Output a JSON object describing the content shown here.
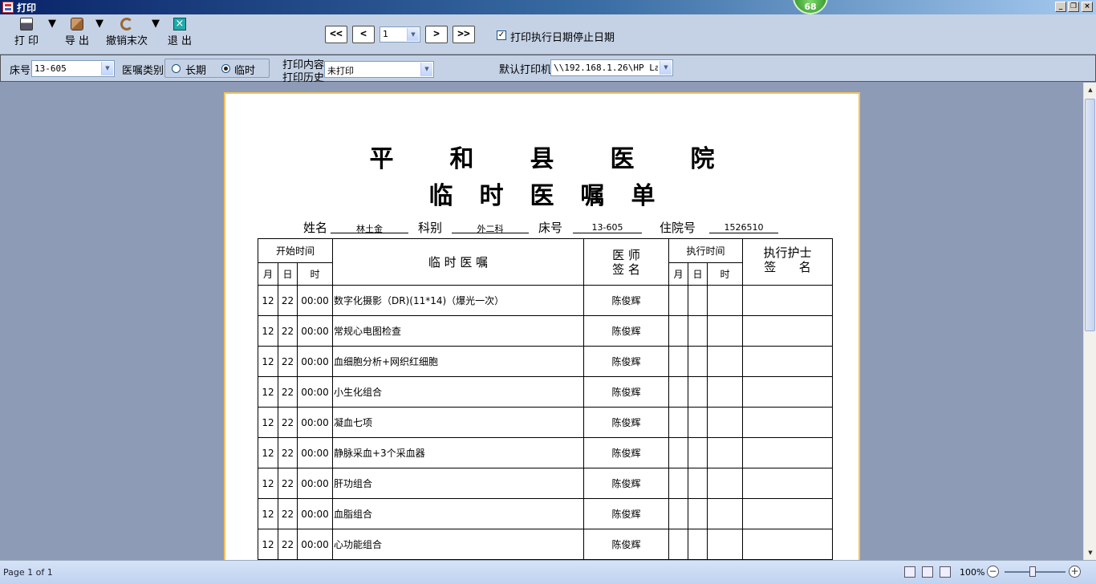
{
  "window": {
    "title": "打印",
    "badge": "68",
    "controls": [
      "_",
      "❐",
      "×"
    ]
  },
  "toolbar": {
    "print_label": "打 印",
    "export_label": "导 出",
    "undo_label": "撤销末次",
    "exit_label": "退 出",
    "nav": {
      "first": "<<",
      "prev": "<",
      "next": ">",
      "last": ">>"
    },
    "page_value": "1",
    "stop_date_checkbox": {
      "label": "打印执行日期停止日期",
      "checked": true
    }
  },
  "filters": {
    "bed_label": "床号",
    "bed_value": "13-605",
    "order_type_label": "医嘱类别",
    "order_type_options": [
      "长期",
      "临时"
    ],
    "order_type_selected": "临时",
    "print_content_label": "打印内容",
    "print_history_label": "打印历史",
    "print_history_value": "未打印",
    "printer_label": "默认打印机",
    "printer_value": "\\\\192.168.1.26\\HP La"
  },
  "document": {
    "hospital": "平和县医院",
    "title": "临时医嘱单",
    "patient": {
      "name_label": "姓名",
      "name": "林土金",
      "dept_label": "科别",
      "dept": "外二科",
      "bed_label": "床号",
      "bed": "13-605",
      "admission_label": "住院号",
      "admission_no": "1526510"
    },
    "table_headers": {
      "start_time": "开始时间",
      "order": "临 时 医 嘱",
      "doctor_line1": "医 师",
      "doctor_line2": "签 名",
      "exec_time": "执行时间",
      "nurse_line1": "执行护士",
      "nurse_line2": "签      名",
      "month": "月",
      "day": "日",
      "time": "时"
    },
    "orders": [
      {
        "month": "12",
        "day": "22",
        "time": "00:00",
        "content": "数字化摄影（DR)(11*14)（爆光一次）",
        "doctor": "陈俊辉"
      },
      {
        "month": "12",
        "day": "22",
        "time": "00:00",
        "content": "常规心电图检查",
        "doctor": "陈俊辉"
      },
      {
        "month": "12",
        "day": "22",
        "time": "00:00",
        "content": "血细胞分析+网织红细胞",
        "doctor": "陈俊辉"
      },
      {
        "month": "12",
        "day": "22",
        "time": "00:00",
        "content": "小生化组合",
        "doctor": "陈俊辉"
      },
      {
        "month": "12",
        "day": "22",
        "time": "00:00",
        "content": "凝血七项",
        "doctor": "陈俊辉"
      },
      {
        "month": "12",
        "day": "22",
        "time": "00:00",
        "content": "静脉采血+3个采血器",
        "doctor": "陈俊辉"
      },
      {
        "month": "12",
        "day": "22",
        "time": "00:00",
        "content": "肝功组合",
        "doctor": "陈俊辉"
      },
      {
        "month": "12",
        "day": "22",
        "time": "00:00",
        "content": "血脂组合",
        "doctor": "陈俊辉"
      },
      {
        "month": "12",
        "day": "22",
        "time": "00:00",
        "content": "心功能组合",
        "doctor": "陈俊辉"
      }
    ]
  },
  "status": {
    "page_info": "Page 1 of 1",
    "zoom": "100%"
  }
}
